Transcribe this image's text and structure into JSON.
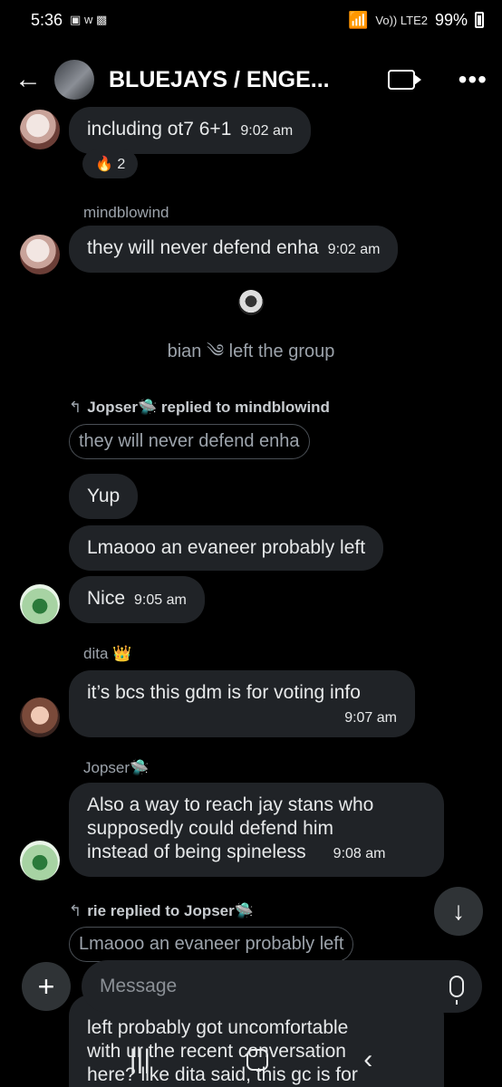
{
  "status": {
    "time": "5:36",
    "notif_icons": "▣ w ▩",
    "net_label": "Vo)) LTE2",
    "battery": "99%"
  },
  "header": {
    "title": "BLUEJAYS / ENGE..."
  },
  "messages": [
    {
      "text": "including ot7 6+1",
      "time": "9:02 am"
    },
    {
      "reaction_emoji": "🔥",
      "reaction_count": "2"
    },
    {
      "sender": "mindblowind",
      "text": "they will never defend enha",
      "time": "9:02 am"
    },
    {
      "system": "bian ༄ left the group"
    },
    {
      "reply_header": "Jopser🛸 replied to mindblowind",
      "quote": "they will never defend enha"
    },
    {
      "text": "Yup"
    },
    {
      "text": "Lmaooo an evaneer probably left"
    },
    {
      "text": "Nice",
      "time": "9:05 am"
    },
    {
      "sender": "dita 👑",
      "text": "it’s bcs this gdm is for voting info",
      "time": "9:07 am"
    },
    {
      "sender": "Jopser🛸",
      "line1": "Also a way to reach jay stans who",
      "line2": "supposedly could defend him",
      "line3": "instead of being spineless",
      "time": "9:08 am"
    },
    {
      "reply_header": "rie replied to Jopser🛸",
      "quote": "Lmaooo an evaneer probably left"
    },
    {
      "line1": "left probably got uncomfortable",
      "line2": "with ur the recent conversation",
      "line3": "here? like dita said, this gc is for"
    }
  ],
  "composer": {
    "placeholder": "Message"
  },
  "icons": {
    "back": "back-arrow-icon",
    "video": "video-call-icon",
    "more": "more-options-icon",
    "scroll": "arrow-down-icon",
    "add": "plus-icon",
    "mic": "microphone-icon"
  },
  "nav": {
    "recents": "|||",
    "back": "‹"
  }
}
